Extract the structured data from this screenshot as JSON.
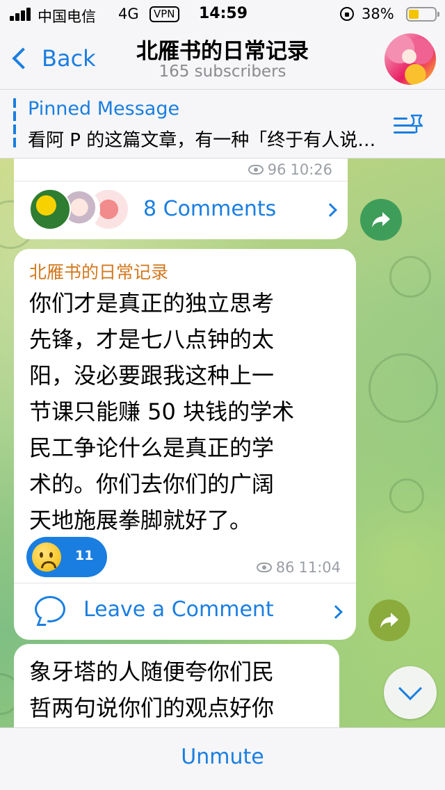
{
  "status_bar": {
    "carrier": "中国电信",
    "network": "4G",
    "vpn": "VPN",
    "time": "14:59",
    "battery": "38%"
  },
  "nav": {
    "back_label": "Back",
    "title": "北雁书的日常记录",
    "subtitle": "165 subscribers"
  },
  "pinned": {
    "title": "Pinned Message",
    "text": "看阿 P 的这篇文章，有一种「终于有人说出来了」的感觉"
  },
  "messages": [
    {
      "views": "96",
      "time": "10:26",
      "comments_label": "8 Comments"
    },
    {
      "sender": "北雁书的日常记录",
      "lines": [
        "你们才是真正的独立思考",
        "先锋，才是七八点钟的太",
        "阳，没必要跟我这种上一",
        "节课只能赚 50 块钱的学术",
        "民工争论什么是真正的学",
        "术的。你们去你们的广阔",
        "天地施展拳脚就好了。"
      ],
      "reaction_count": "11",
      "views": "86",
      "time": "11:04",
      "comment_label": "Leave a Comment"
    },
    {
      "lines": [
        "象牙塔的人随便夸你们民",
        "哲两句说你们的观点好你"
      ]
    }
  ],
  "bottom": {
    "unmute_label": "Unmute"
  },
  "colors": {
    "accent": "#1a7ee0",
    "sender": "#d2781e"
  }
}
